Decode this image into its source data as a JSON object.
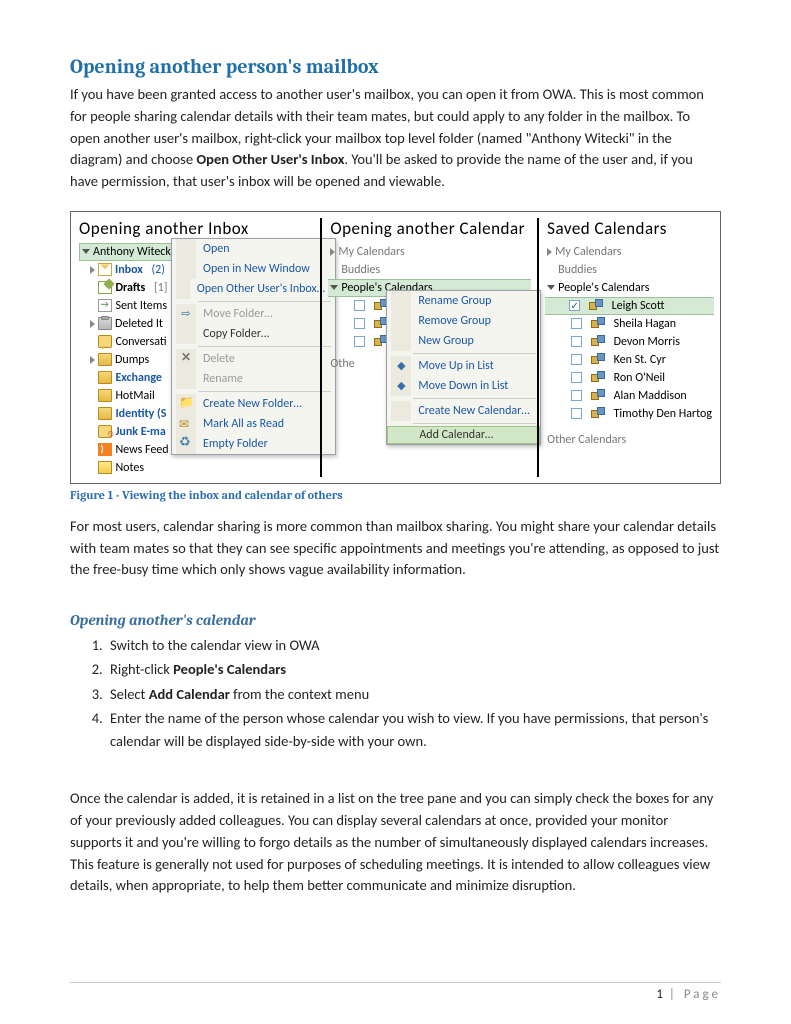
{
  "title": "Opening another person's mailbox",
  "p1_a": "If you have been granted access to another user's mailbox, you can open it from OWA. This is most common for people sharing calendar details with their team mates, but could apply to any folder in the mailbox. To open another user's mailbox, right-click your mailbox top level folder (named \"Anthony Witecki\" in the diagram) and choose ",
  "p1_bold": "Open Other User's Inbox",
  "p1_b": ". You'll be asked to provide the name of the user and, if you have permission, that user's inbox will be opened and viewable.",
  "fig": {
    "col1_h": "Opening  another  Inbox",
    "col2_h": "Opening  another  Calendar",
    "col3_h": "Saved  Calendars",
    "root": "Anthony Witecki",
    "inbox": "Inbox",
    "inbox_badge": "(2)",
    "drafts": "Drafts",
    "drafts_b": "[1]",
    "sent": "Sent Items",
    "deleted": "Deleted It",
    "conv": "Conversati",
    "dumps": "Dumps",
    "exch": "Exchange",
    "hot": "HotMail",
    "ident": "Identity  (S",
    "junk": "Junk E-ma",
    "news": "News Feed",
    "notes": "Notes",
    "m_open": "Open",
    "m_openwin": "Open in New Window",
    "m_openother": "Open Other User's Inbox…",
    "m_move": "Move Folder…",
    "m_copy": "Copy Folder…",
    "m_delete": "Delete",
    "m_rename": "Rename",
    "m_create": "Create New Folder…",
    "m_mark": "Mark All as Read",
    "m_empty": "Empty Folder",
    "c_mycal": "My Calendars",
    "c_buddies": "Buddies",
    "c_people": "People's Calendars",
    "c_other": "Othe",
    "m2_reng": "Rename Group",
    "m2_remg": "Remove Group",
    "m2_newg": "New Group",
    "m2_up": "Move Up in List",
    "m2_down": "Move Down in List",
    "m2_newcal": "Create New Calendar…",
    "m2_addcal": "Add Calendar…",
    "s_mycal": "My Calendars",
    "s_buddies": "Buddies",
    "s_people": "People's Calendars",
    "s_leigh": "Leigh Scott",
    "s_sheila": "Sheila Hagan",
    "s_devon": "Devon Morris",
    "s_ken": "Ken St. Cyr",
    "s_ron": "Ron O'Neil",
    "s_alan": "Alan Maddison",
    "s_tim": "Timothy Den Hartog",
    "s_other": "Other Calendars"
  },
  "caption": "Figure 1 - Viewing the inbox and calendar of others",
  "p2": "For most users, calendar sharing is more common than mailbox sharing. You might share your calendar details with team mates so that they can see specific appointments and meetings you're attending, as opposed to just the free-busy time which only shows vague availability information.",
  "h2": "Opening another's calendar",
  "s1": "Switch to the calendar view in OWA",
  "s2a": "Right-click ",
  "s2b": "People's Calendars",
  "s3a": "Select ",
  "s3b": "Add Calendar",
  "s3c": " from the context menu",
  "s4": "Enter the name of the person whose calendar you wish to view. If you have permissions, that person's calendar will be displayed side-by-side with your own.",
  "p3": "Once the calendar is added, it is retained in a list on the tree pane and you can simply check the boxes for any of your previously added colleagues. You can display several calendars at once, provided your monitor supports it and you're willing to forgo details as the number of simultaneously displayed calendars increases. This feature is generally not used for purposes of scheduling meetings. It is intended to allow colleagues view details, when appropriate, to help them better communicate and minimize disruption.",
  "footer_num": "1",
  "footer_txt": " | Page"
}
